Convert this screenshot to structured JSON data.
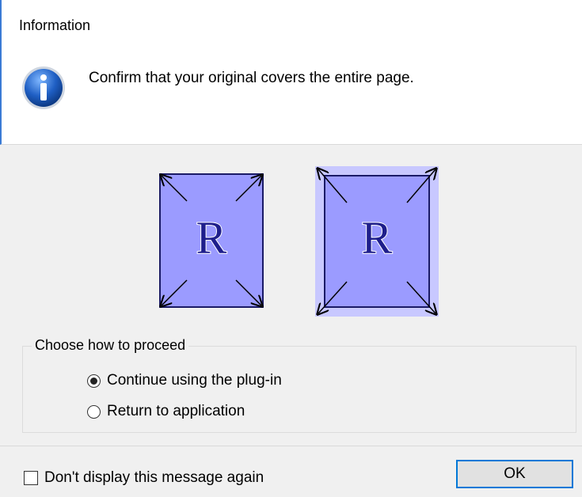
{
  "window": {
    "title": "Information"
  },
  "message": {
    "text": "Confirm that your original covers the entire page."
  },
  "illustration": {
    "letter": "R",
    "colors": {
      "page_fill": "#9b9bff",
      "border": "#1a1a66",
      "highlight": "#c8c8ff",
      "letter": "#1e1e8c"
    }
  },
  "options": {
    "group_label": "Choose how to proceed",
    "items": [
      {
        "label": "Continue using the plug-in",
        "selected": true
      },
      {
        "label": "Return to application",
        "selected": false
      }
    ]
  },
  "footer": {
    "checkbox_label": "Don't display this message again",
    "checked": false,
    "ok_label": "OK"
  },
  "colors": {
    "accent": "#0078d7",
    "background": "#f0f0f0"
  }
}
